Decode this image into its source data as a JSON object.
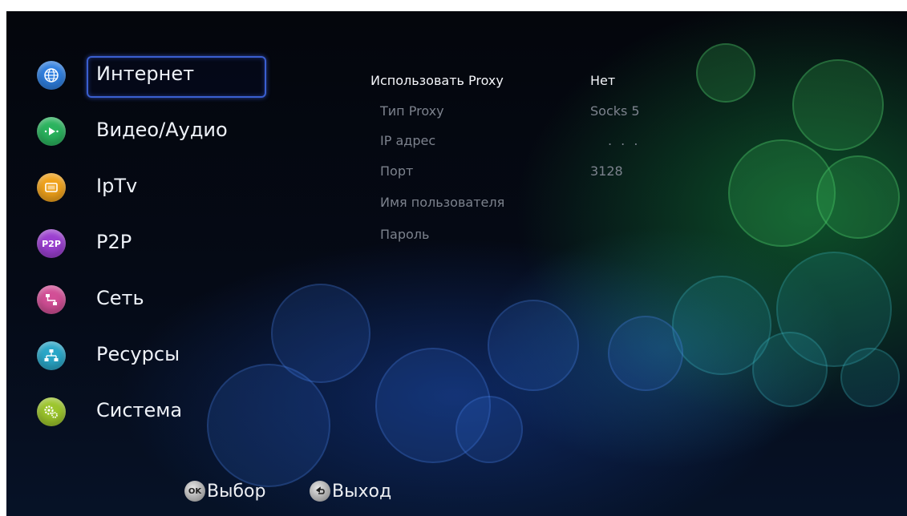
{
  "menu": {
    "items": [
      {
        "label": "Интернет",
        "icon": "globe-icon",
        "color": "#2f7fe0",
        "selected": true
      },
      {
        "label": "Видео/Аудио",
        "icon": "media-icon",
        "color": "#2bb35e",
        "selected": false
      },
      {
        "label": "IpTv",
        "icon": "tv-icon",
        "color": "#f0a21b",
        "selected": false
      },
      {
        "label": "P2P",
        "icon": "p2p-icon",
        "color": "#9b3fd0",
        "selected": false,
        "badge": "P2P"
      },
      {
        "label": "Сеть",
        "icon": "network-icon",
        "color": "#d24f96",
        "selected": false
      },
      {
        "label": "Ресурсы",
        "icon": "resources-icon",
        "color": "#2aa7c8",
        "selected": false
      },
      {
        "label": "Система",
        "icon": "system-gear-icon",
        "color": "#9cc52c",
        "selected": false
      }
    ]
  },
  "settings": {
    "rows": [
      {
        "label": "Использовать Proxy",
        "value": "Нет",
        "active": true
      },
      {
        "label": "Тип Proxy",
        "value": "Socks 5",
        "active": false
      },
      {
        "label": "IP адрес",
        "value": ". . .",
        "active": false
      },
      {
        "label": "Порт",
        "value": "3128",
        "active": false
      },
      {
        "label": "Имя пользователя",
        "value": "",
        "active": false
      },
      {
        "label": "Пароль",
        "value": "",
        "active": false
      }
    ]
  },
  "footer": {
    "ok_badge": "OK",
    "ok_label": "Выбор",
    "back_label": "Выход"
  }
}
